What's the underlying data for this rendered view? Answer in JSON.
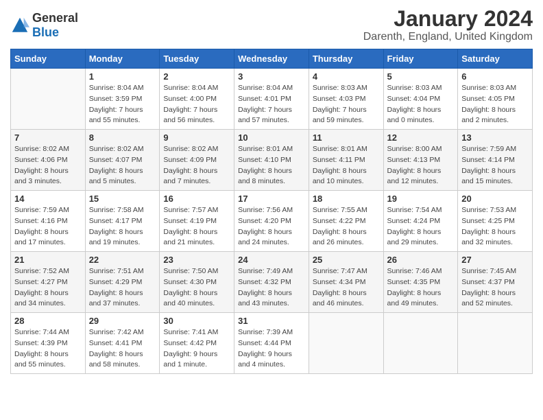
{
  "logo": {
    "general": "General",
    "blue": "Blue"
  },
  "title": "January 2024",
  "location": "Darenth, England, United Kingdom",
  "days_of_week": [
    "Sunday",
    "Monday",
    "Tuesday",
    "Wednesday",
    "Thursday",
    "Friday",
    "Saturday"
  ],
  "weeks": [
    [
      {
        "day": "",
        "info": ""
      },
      {
        "day": "1",
        "info": "Sunrise: 8:04 AM\nSunset: 3:59 PM\nDaylight: 7 hours\nand 55 minutes."
      },
      {
        "day": "2",
        "info": "Sunrise: 8:04 AM\nSunset: 4:00 PM\nDaylight: 7 hours\nand 56 minutes."
      },
      {
        "day": "3",
        "info": "Sunrise: 8:04 AM\nSunset: 4:01 PM\nDaylight: 7 hours\nand 57 minutes."
      },
      {
        "day": "4",
        "info": "Sunrise: 8:03 AM\nSunset: 4:03 PM\nDaylight: 7 hours\nand 59 minutes."
      },
      {
        "day": "5",
        "info": "Sunrise: 8:03 AM\nSunset: 4:04 PM\nDaylight: 8 hours\nand 0 minutes."
      },
      {
        "day": "6",
        "info": "Sunrise: 8:03 AM\nSunset: 4:05 PM\nDaylight: 8 hours\nand 2 minutes."
      }
    ],
    [
      {
        "day": "7",
        "info": "Sunrise: 8:02 AM\nSunset: 4:06 PM\nDaylight: 8 hours\nand 3 minutes."
      },
      {
        "day": "8",
        "info": "Sunrise: 8:02 AM\nSunset: 4:07 PM\nDaylight: 8 hours\nand 5 minutes."
      },
      {
        "day": "9",
        "info": "Sunrise: 8:02 AM\nSunset: 4:09 PM\nDaylight: 8 hours\nand 7 minutes."
      },
      {
        "day": "10",
        "info": "Sunrise: 8:01 AM\nSunset: 4:10 PM\nDaylight: 8 hours\nand 8 minutes."
      },
      {
        "day": "11",
        "info": "Sunrise: 8:01 AM\nSunset: 4:11 PM\nDaylight: 8 hours\nand 10 minutes."
      },
      {
        "day": "12",
        "info": "Sunrise: 8:00 AM\nSunset: 4:13 PM\nDaylight: 8 hours\nand 12 minutes."
      },
      {
        "day": "13",
        "info": "Sunrise: 7:59 AM\nSunset: 4:14 PM\nDaylight: 8 hours\nand 15 minutes."
      }
    ],
    [
      {
        "day": "14",
        "info": "Sunrise: 7:59 AM\nSunset: 4:16 PM\nDaylight: 8 hours\nand 17 minutes."
      },
      {
        "day": "15",
        "info": "Sunrise: 7:58 AM\nSunset: 4:17 PM\nDaylight: 8 hours\nand 19 minutes."
      },
      {
        "day": "16",
        "info": "Sunrise: 7:57 AM\nSunset: 4:19 PM\nDaylight: 8 hours\nand 21 minutes."
      },
      {
        "day": "17",
        "info": "Sunrise: 7:56 AM\nSunset: 4:20 PM\nDaylight: 8 hours\nand 24 minutes."
      },
      {
        "day": "18",
        "info": "Sunrise: 7:55 AM\nSunset: 4:22 PM\nDaylight: 8 hours\nand 26 minutes."
      },
      {
        "day": "19",
        "info": "Sunrise: 7:54 AM\nSunset: 4:24 PM\nDaylight: 8 hours\nand 29 minutes."
      },
      {
        "day": "20",
        "info": "Sunrise: 7:53 AM\nSunset: 4:25 PM\nDaylight: 8 hours\nand 32 minutes."
      }
    ],
    [
      {
        "day": "21",
        "info": "Sunrise: 7:52 AM\nSunset: 4:27 PM\nDaylight: 8 hours\nand 34 minutes."
      },
      {
        "day": "22",
        "info": "Sunrise: 7:51 AM\nSunset: 4:29 PM\nDaylight: 8 hours\nand 37 minutes."
      },
      {
        "day": "23",
        "info": "Sunrise: 7:50 AM\nSunset: 4:30 PM\nDaylight: 8 hours\nand 40 minutes."
      },
      {
        "day": "24",
        "info": "Sunrise: 7:49 AM\nSunset: 4:32 PM\nDaylight: 8 hours\nand 43 minutes."
      },
      {
        "day": "25",
        "info": "Sunrise: 7:47 AM\nSunset: 4:34 PM\nDaylight: 8 hours\nand 46 minutes."
      },
      {
        "day": "26",
        "info": "Sunrise: 7:46 AM\nSunset: 4:35 PM\nDaylight: 8 hours\nand 49 minutes."
      },
      {
        "day": "27",
        "info": "Sunrise: 7:45 AM\nSunset: 4:37 PM\nDaylight: 8 hours\nand 52 minutes."
      }
    ],
    [
      {
        "day": "28",
        "info": "Sunrise: 7:44 AM\nSunset: 4:39 PM\nDaylight: 8 hours\nand 55 minutes."
      },
      {
        "day": "29",
        "info": "Sunrise: 7:42 AM\nSunset: 4:41 PM\nDaylight: 8 hours\nand 58 minutes."
      },
      {
        "day": "30",
        "info": "Sunrise: 7:41 AM\nSunset: 4:42 PM\nDaylight: 9 hours\nand 1 minute."
      },
      {
        "day": "31",
        "info": "Sunrise: 7:39 AM\nSunset: 4:44 PM\nDaylight: 9 hours\nand 4 minutes."
      },
      {
        "day": "",
        "info": ""
      },
      {
        "day": "",
        "info": ""
      },
      {
        "day": "",
        "info": ""
      }
    ]
  ]
}
